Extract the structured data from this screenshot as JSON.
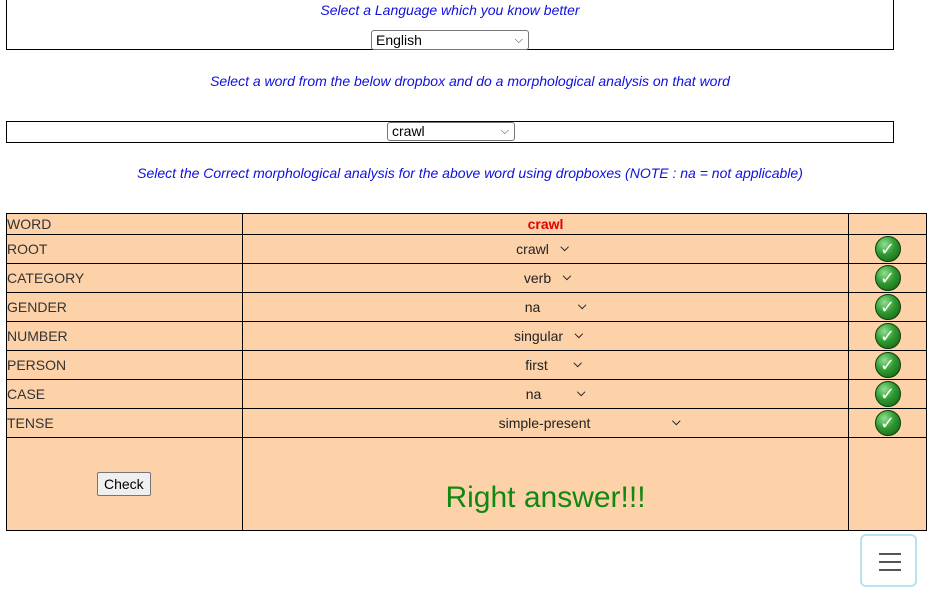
{
  "language": {
    "hint": "Select a Language which you know better",
    "selected": "English"
  },
  "word_select": {
    "hint": "Select a word from the below dropbox and do a morphological analysis on that word",
    "selected": "crawl"
  },
  "analysis": {
    "hint": "Select the Correct morphological analysis for the above word using dropboxes (NOTE : na = not applicable)",
    "word_label": "WORD",
    "word_value": "crawl",
    "rows": [
      {
        "label": "ROOT",
        "value": "crawl",
        "correct": true
      },
      {
        "label": "CATEGORY",
        "value": "verb",
        "correct": true
      },
      {
        "label": "GENDER",
        "value": "na",
        "correct": true
      },
      {
        "label": "NUMBER",
        "value": "singular",
        "correct": true
      },
      {
        "label": "PERSON",
        "value": "first",
        "correct": true
      },
      {
        "label": "CASE",
        "value": "na",
        "correct": true
      },
      {
        "label": "TENSE",
        "value": "simple-present",
        "correct": true
      }
    ],
    "check_label": "Check",
    "result": "Right answer!!!"
  },
  "icons": {
    "tick": "check-mark-icon",
    "menu": "hamburger-menu-icon",
    "chevron": "chevron-down-icon"
  },
  "colors": {
    "hint": "#1010dd",
    "table_bg": "#fed2a9",
    "word_value": "#e00000",
    "result": "#118811"
  }
}
